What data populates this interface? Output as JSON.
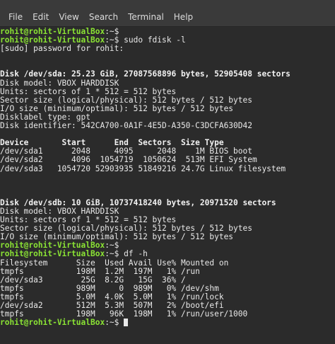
{
  "menu": {
    "file": "File",
    "edit": "Edit",
    "view": "View",
    "search": "Search",
    "terminal": "Terminal",
    "help": "Help"
  },
  "prompt": {
    "user": "rohit@rohit-VirtualBox",
    "suffix": ":~$"
  },
  "commands": {
    "fdisk": " sudo fdisk -l",
    "df": " df -h"
  },
  "output": {
    "sudo_prompt": "[sudo] password for rohit:",
    "sda_header": "Disk /dev/sda: 25.23 GiB, 27087568896 bytes, 52905408 sectors",
    "sda_model": "Disk model: VBOX HARDDISK",
    "sda_units": "Units: sectors of 1 * 512 = 512 bytes",
    "sda_sector": "Sector size (logical/physical): 512 bytes / 512 bytes",
    "sda_io": "I/O size (minimum/optimal): 512 bytes / 512 bytes",
    "sda_label": "Disklabel type: gpt",
    "sda_ident": "Disk identifier: 542CA700-0A1F-4E5D-A350-C3DCFA630D42",
    "part_header": "Device       Start      End  Sectors  Size Type",
    "part_rows": [
      "/dev/sda1      2048     4095     2048    1M BIOS boot",
      "/dev/sda2      4096  1054719  1050624  513M EFI System",
      "/dev/sda3   1054720 52903935 51849216 24.7G Linux filesystem"
    ],
    "sdb_header": "Disk /dev/sdb: 10 GiB, 10737418240 bytes, 20971520 sectors",
    "sdb_model": "Disk model: VBOX HARDDISK",
    "sdb_units": "Units: sectors of 1 * 512 = 512 bytes",
    "sdb_sector": "Sector size (logical/physical): 512 bytes / 512 bytes",
    "sdb_io": "I/O size (minimum/optimal): 512 bytes / 512 bytes",
    "df_header": "Filesystem      Size  Used Avail Use% Mounted on",
    "df_rows": [
      "tmpfs           198M  1.2M  197M   1% /run",
      "/dev/sda3        25G  8.2G   15G  36% /",
      "tmpfs           989M     0  989M   0% /dev/shm",
      "tmpfs           5.0M  4.0K  5.0M   1% /run/lock",
      "/dev/sda2       512M  5.3M  507M   2% /boot/efi",
      "tmpfs           198M   96K  198M   1% /run/user/1000"
    ]
  }
}
